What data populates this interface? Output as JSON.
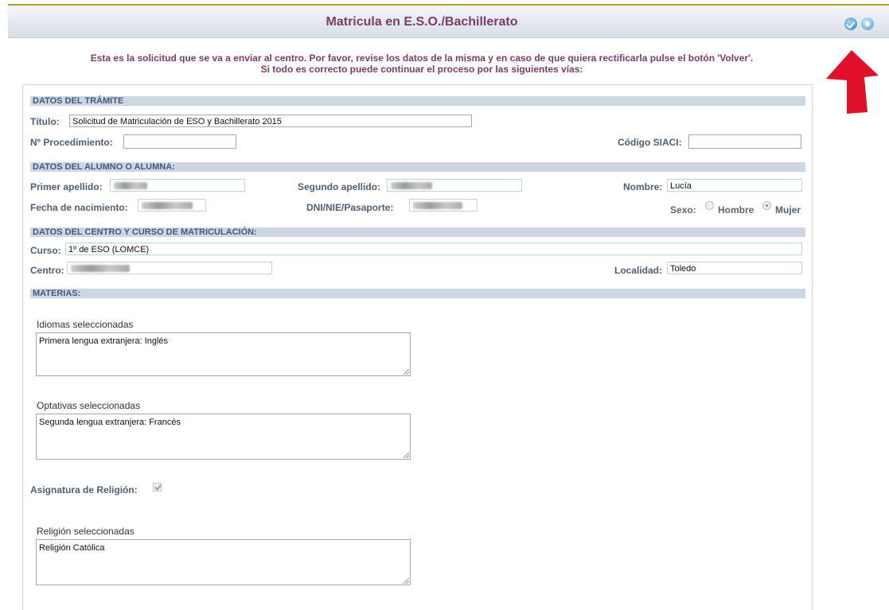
{
  "header": {
    "title": "Matricula en E.S.O./Bachillerato"
  },
  "notice": {
    "line1": "Esta es la solicitud que se va a enviar al centro. Por favor, revise los datos de la misma y en caso de que quiera rectificarla pulse el botón 'Volver'.",
    "line2": "Si todo es correcto puede continuar el proceso por las siguientes vías:"
  },
  "tramite": {
    "section": "DATOS DEL TRÁMITE",
    "titulo_label": "Título:",
    "titulo_value": "Solicitud de Matriculación de ESO y Bachillerato 2015",
    "procedimiento_label": "Nº Procedimiento:",
    "procedimiento_value": "",
    "siaci_label": "Código SIACI:",
    "siaci_value": ""
  },
  "alumno": {
    "section": "DATOS DEL ALUMNO O ALUMNA:",
    "primer_apellido_label": "Primer apellido:",
    "segundo_apellido_label": "Segundo apellido:",
    "nombre_label": "Nombre:",
    "nombre_value": "Lucía",
    "fecha_label": "Fecha de nacimiento:",
    "dni_label": "DNI/NIE/Pasaporte:",
    "sexo_label": "Sexo:",
    "hombre_label": "Hombre",
    "mujer_label": "Mujer",
    "sexo_selected": "Mujer"
  },
  "centro": {
    "section": "DATOS DEL CENTRO Y CURSO DE MATRICULACIÓN:",
    "curso_label": "Curso:",
    "curso_value": "1º de ESO (LOMCE)",
    "centro_label": "Centro:",
    "localidad_label": "Localidad:",
    "localidad_value": "Toledo"
  },
  "materias": {
    "section": "MATERIAS:",
    "idiomas_label": "Idiomas seleccionadas",
    "idiomas_value": "Primera lengua extranjera: Inglés",
    "optativas_label": "Optativas seleccionadas",
    "optativas_value": "Segunda lengua extranjera: Francés",
    "religion_check_label": "Asignatura de Religión:",
    "religion_checked": true,
    "religion_label": "Religión seleccionadas",
    "religion_value": "Religión Católica"
  },
  "icons": {
    "confirm": "check-circle-icon",
    "next": "next-circle-icon",
    "annotation": "red-up-arrow"
  },
  "colors": {
    "title": "#7a3c6b",
    "section_bg": "#cdd6e3",
    "arrow": "#e0102a"
  }
}
